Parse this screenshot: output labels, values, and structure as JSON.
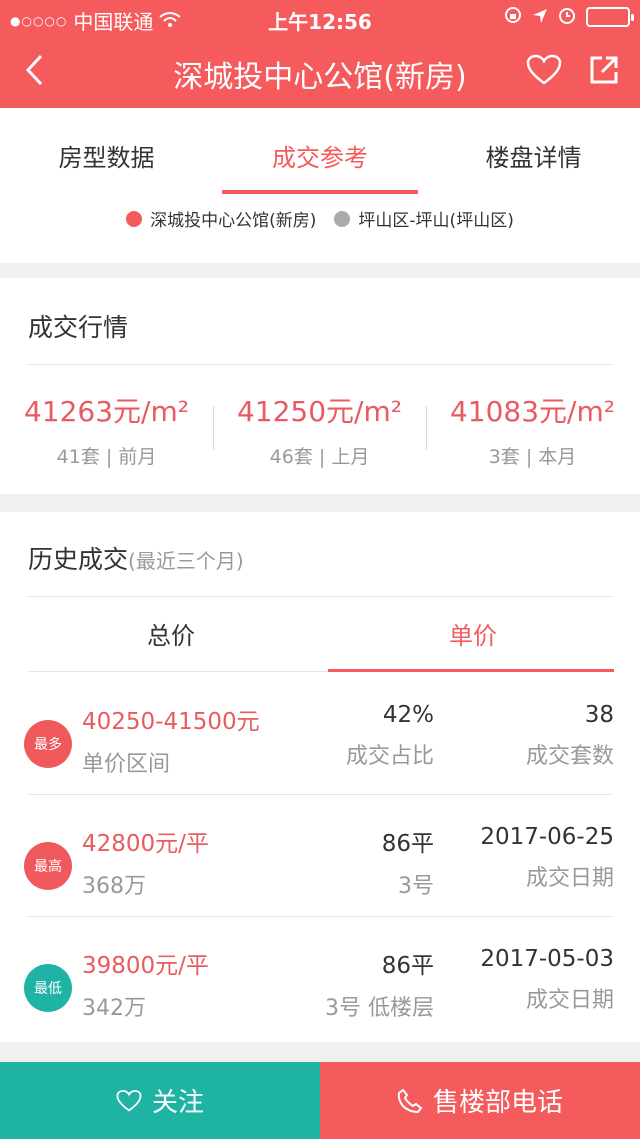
{
  "status_bar": {
    "signal": "●○○○○",
    "carrier": "中国联通",
    "time": "上午12:56",
    "icons": [
      "wifi-icon",
      "rotation-lock-icon",
      "location-icon",
      "alarm-icon",
      "battery-icon"
    ]
  },
  "nav": {
    "title": "深城投中心公馆(新房)",
    "back_icon": "chevron-left-icon",
    "favorite_icon": "heart-icon",
    "share_icon": "share-icon"
  },
  "tabs": [
    {
      "label": "房型数据",
      "active": false
    },
    {
      "label": "成交参考",
      "active": true
    },
    {
      "label": "楼盘详情",
      "active": false
    }
  ],
  "legend": [
    {
      "label": "深城投中心公馆(新房)",
      "color": "#f55a5c"
    },
    {
      "label": "坪山区-坪山(坪山区)",
      "color": "#aaaaaa"
    }
  ],
  "market": {
    "title": "成交行情",
    "stats": [
      {
        "price": "41263元/m²",
        "count": "41套",
        "period": "前月"
      },
      {
        "price": "41250元/m²",
        "count": "46套",
        "period": "上月"
      },
      {
        "price": "41083元/m²",
        "count": "3套",
        "period": "本月"
      }
    ]
  },
  "history": {
    "title": "历史成交",
    "hint": "(最近三个月)",
    "subtabs": [
      {
        "label": "总价",
        "active": false
      },
      {
        "label": "单价",
        "active": true
      }
    ],
    "rows": [
      {
        "badge": "最多",
        "badge_color": "#f0595c",
        "c1_main": "40250-41500元",
        "c1_minor": "单价区间",
        "c2_main": "42%",
        "c2_minor": "成交占比",
        "c3_main": "38",
        "c3_minor": "成交套数"
      },
      {
        "badge": "最高",
        "badge_color": "#f0595c",
        "c1_main": "42800元/平",
        "c1_minor": "368万",
        "c2_main": "86平",
        "c2_minor": "3号",
        "c3_main": "2017-06-25",
        "c3_minor": "成交日期"
      },
      {
        "badge": "最低",
        "badge_color": "#1fb3a4",
        "c1_main": "39800元/平",
        "c1_minor": "342万",
        "c2_main": "86平",
        "c2_minor": "3号 低楼层",
        "c3_main": "2017-05-03",
        "c3_minor": "成交日期"
      }
    ]
  },
  "bottom_bar": {
    "follow_label": "关注",
    "phone_label": "售楼部电话",
    "follow_color": "#1fb3a4",
    "phone_color": "#f55a5c"
  },
  "colors": {
    "accent": "#f55a5c",
    "teal": "#1fb3a4"
  }
}
